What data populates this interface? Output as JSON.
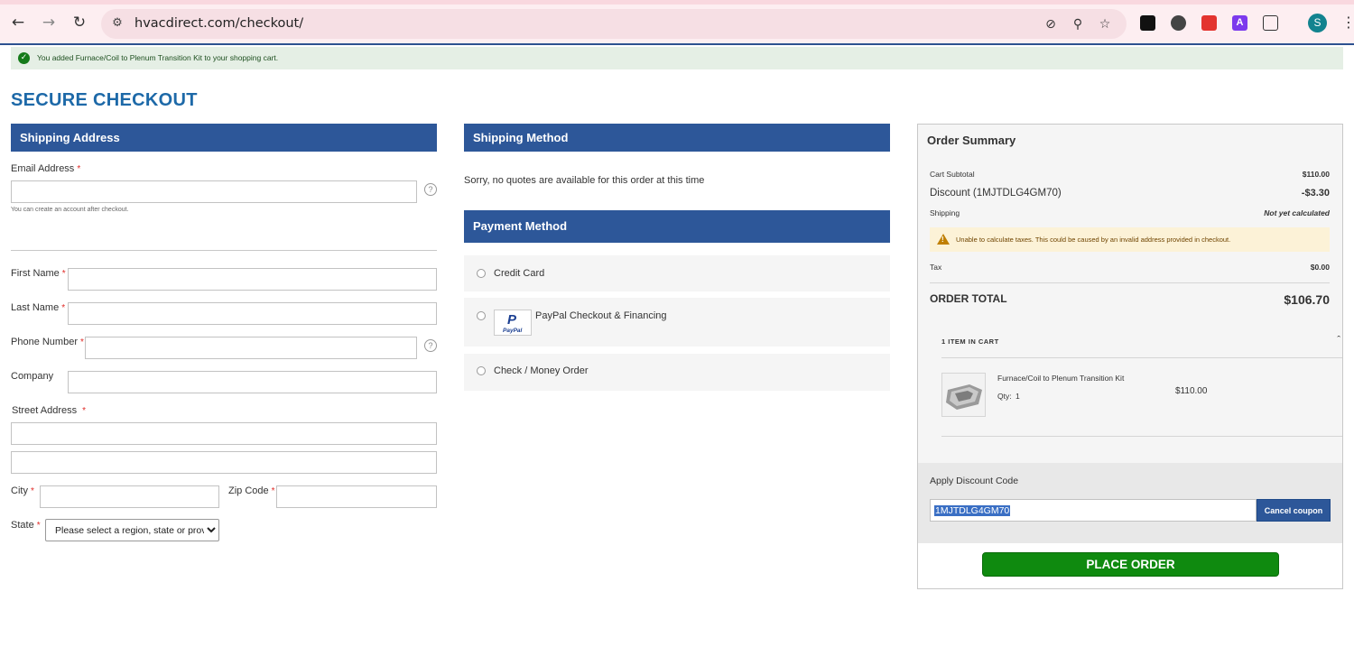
{
  "browser": {
    "url": "hvacdirect.com/checkout/",
    "avatar_letter": "S",
    "extensions": [
      "puzzle-icon"
    ],
    "accent_color": "#2d5190"
  },
  "message": {
    "text": "You added Furnace/Coil to Plenum Transition Kit to your shopping cart."
  },
  "page": {
    "title": "SECURE CHECKOUT"
  },
  "shipping_address": {
    "heading": "Shipping Address",
    "email_label": "Email Address",
    "email_hint": "You can create an account after checkout.",
    "first_name_label": "First Name",
    "last_name_label": "Last Name",
    "phone_label": "Phone Number",
    "company_label": "Company",
    "street_label": "Street Address",
    "city_label": "City",
    "zip_label": "Zip Code",
    "state_label": "State",
    "state_selected": "Please select a region, state or province.",
    "required_mark": "*",
    "help_mark": "?"
  },
  "shipping_method": {
    "heading": "Shipping Method",
    "notice": "Sorry, no quotes are available for this order at this time"
  },
  "payment_method": {
    "heading": "Payment Method",
    "options": [
      {
        "label": "Credit Card"
      },
      {
        "label": "PayPal Checkout & Financing",
        "logo_text": "PayPal"
      },
      {
        "label": "Check / Money Order"
      }
    ]
  },
  "order_summary": {
    "title": "Order Summary",
    "cart_subtotal_label": "Cart Subtotal",
    "cart_subtotal_value": "$110.00",
    "discount_label": "Discount (1MJTDLG4GM70)",
    "discount_value": "-$3.30",
    "shipping_label": "Shipping",
    "shipping_value": "Not yet calculated",
    "tax_warning": "Unable to calculate taxes. This could be caused by an invalid address provided in checkout.",
    "tax_label": "Tax",
    "tax_value": "$0.00",
    "total_label": "ORDER TOTAL",
    "total_value": "$106.70",
    "items_in_cart": "1 ITEM IN CART",
    "item": {
      "name": "Furnace/Coil to Plenum Transition Kit",
      "qty_label": "Qty:",
      "qty": "1",
      "price": "$110.00"
    },
    "discount_code_label": "Apply Discount Code",
    "discount_code_value": "1MJTDLG4GM70",
    "cancel_coupon_label": "Cancel coupon",
    "place_order_label": "PLACE ORDER",
    "place_order_color": "#0f8a0f"
  }
}
